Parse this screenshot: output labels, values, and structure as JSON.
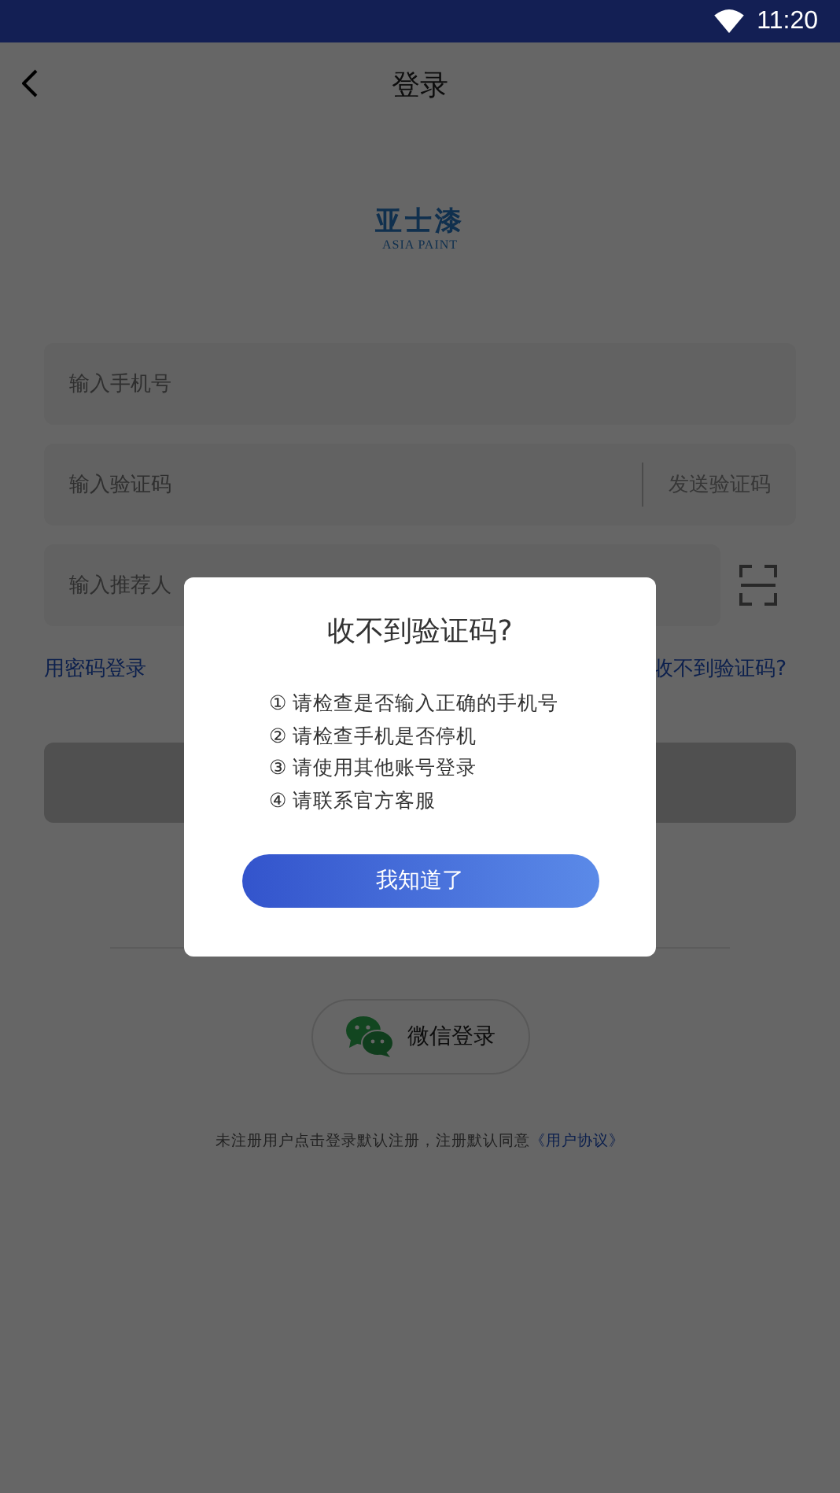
{
  "status_bar": {
    "time": "11:20"
  },
  "header": {
    "title": "登录"
  },
  "logo": {
    "name": "亚士漆",
    "tagline": "ASIA PAINT"
  },
  "fields": [
    {
      "kind": "phone",
      "placeholder": "输入手机号"
    },
    {
      "kind": "code",
      "placeholder": "输入验证码",
      "action": "发送验证码"
    },
    {
      "kind": "referrer",
      "placeholder": "输入推荐人"
    }
  ],
  "links": {
    "password_login": "用密码登录",
    "no_code": "收不到验证码?"
  },
  "wechat_login": {
    "label": "微信登录"
  },
  "footer": {
    "text": "未注册用户点击登录默认注册，注册默认同意",
    "link": "《用户协议》"
  },
  "dialog": {
    "title": "收不到验证码?",
    "items": [
      "① 请检查是否输入正确的手机号",
      "② 请检查手机是否停机",
      "③ 请使用其他账号登录",
      "④ 请联系官方客服"
    ],
    "button": "我知道了"
  }
}
